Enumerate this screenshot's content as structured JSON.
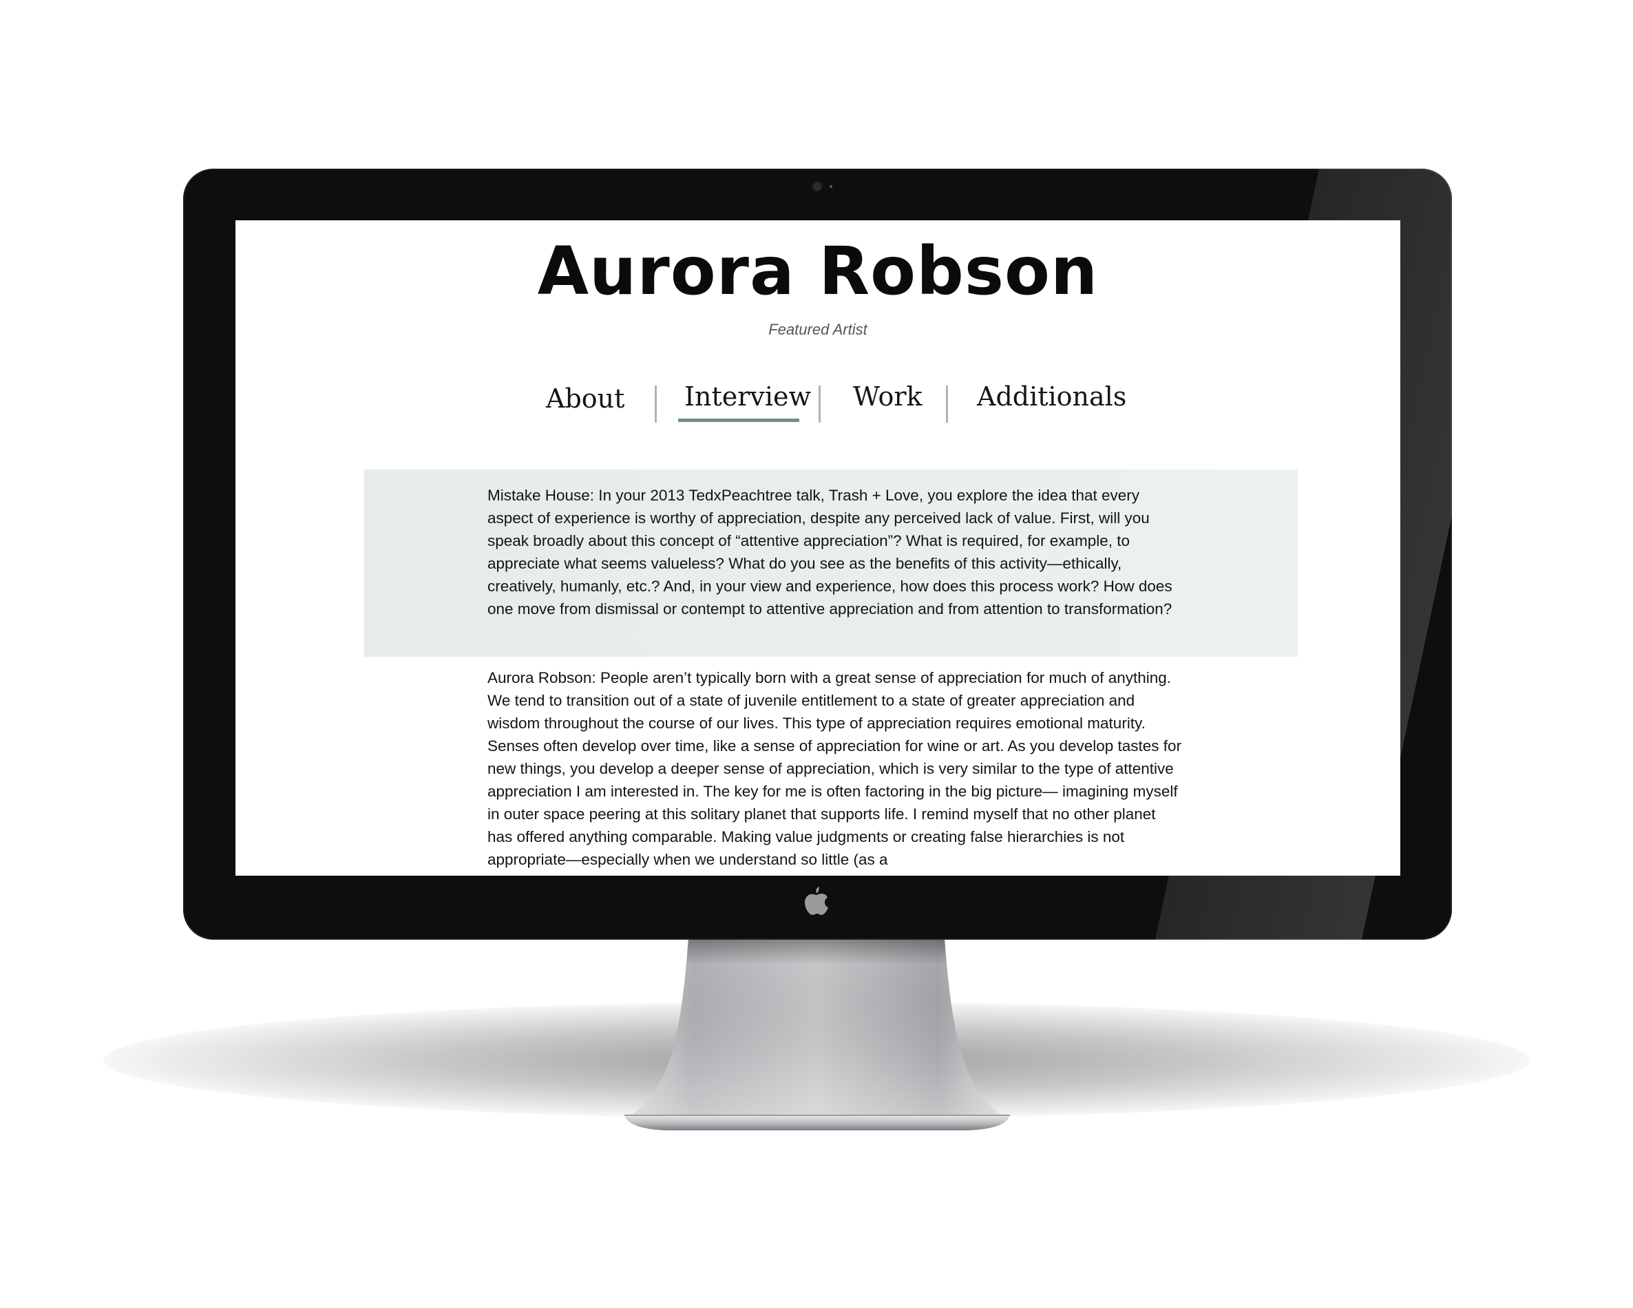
{
  "site": {
    "title": "Aurora Robson",
    "subtitle": "Featured Artist"
  },
  "nav": {
    "items": [
      {
        "label": "About"
      },
      {
        "label": "Interview",
        "active": true
      },
      {
        "label": "Work"
      },
      {
        "label": "Additionals"
      }
    ]
  },
  "interview": {
    "question": "Mistake House: In your 2013 TedxPeachtree talk, Trash + Love, you explore the idea that every aspect of experience is worthy of appreciation, despite any perceived lack of value.  First, will you speak broadly about this concept of “attentive appreciation”? What is required, for example, to appreciate what seems valueless? What do you see as the benefits of this activity—ethically, creatively, humanly, etc.? And, in your view and experience, how does this process work? How does one move from dismissal or contempt to attentive appreciation and from attention to transformation?",
    "answer": "Aurora Robson: People aren’t typically born with a great sense of appreciation for much of anything. We tend to transition out of a state of juvenile entitlement to a state of greater appreciation and wisdom throughout the course of our lives. This type of appreciation requires emotional maturity. Senses often develop over time, like a sense of appreciation for wine or art. As you develop tastes for new things, you develop a deeper sense of appreciation, which is very similar to the type of attentive appreciation I am interested in. The key for me is often factoring in the big picture— imagining myself in outer space peering at this solitary planet that supports life. I remind myself that no other planet has offered anything comparable. Making value judgments or creating false hierarchies is not appropriate—especially when we understand so little (as a"
  },
  "device": {
    "bezel_color": "#0e0e0e",
    "accent_color": "#6f9087",
    "logo_icon": "apple-logo-icon"
  }
}
